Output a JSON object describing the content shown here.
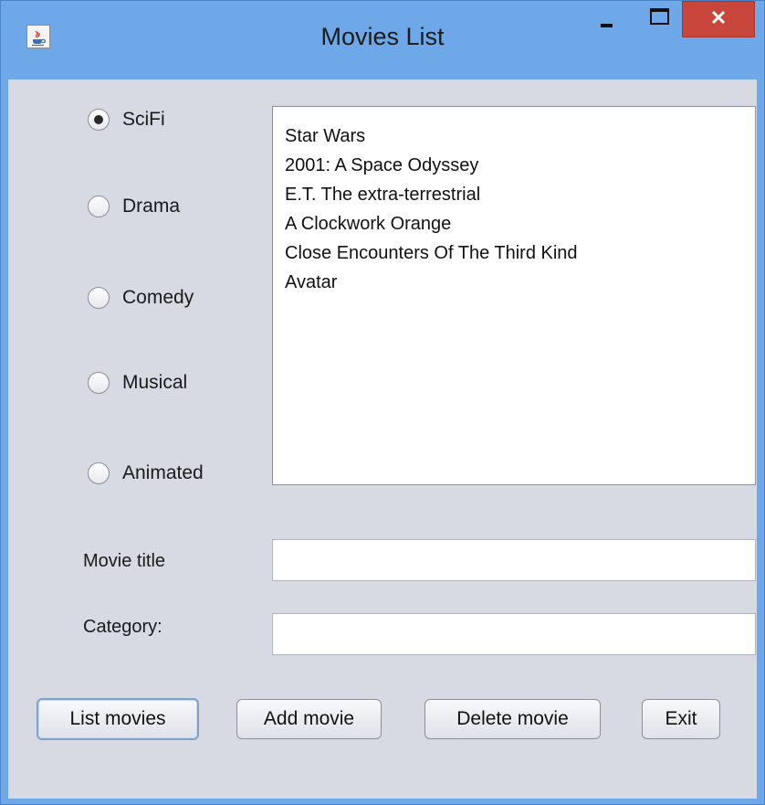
{
  "window": {
    "title": "Movies List",
    "title_bar_color": "#6fa8e8",
    "close_button_color": "#c9463d",
    "client_background": "#d7dae3"
  },
  "icons": {
    "app": "java-cup-icon",
    "minimize": "minimize-icon",
    "maximize": "maximize-icon",
    "close": "close-icon"
  },
  "categories": [
    {
      "label": "SciFi",
      "checked": true
    },
    {
      "label": "Drama",
      "checked": false
    },
    {
      "label": "Comedy",
      "checked": false
    },
    {
      "label": "Musical",
      "checked": false
    },
    {
      "label": "Animated",
      "checked": false
    }
  ],
  "movies": [
    "Star Wars",
    "2001: A Space Odyssey",
    "E.T. The extra-terrestrial",
    "A Clockwork Orange",
    "Close Encounters Of The Third Kind",
    "Avatar"
  ],
  "form": {
    "title_label": "Movie title",
    "title_value": "",
    "category_label": "Category:",
    "category_value": ""
  },
  "buttons": {
    "list": "List movies",
    "add": "Add movie",
    "delete": "Delete movie",
    "exit": "Exit"
  }
}
